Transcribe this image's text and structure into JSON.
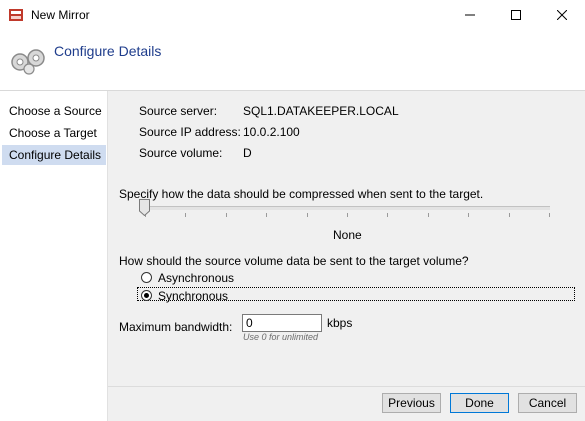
{
  "window": {
    "title": "New Mirror",
    "icon": "mirror-app-icon",
    "controls": {
      "minimize_icon": "minimize-icon",
      "maximize_icon": "maximize-icon",
      "close_icon": "close-icon"
    }
  },
  "header": {
    "title": "Configure Details",
    "icon": "gears-icon",
    "title_color": "#1f3d8c"
  },
  "sidebar": {
    "items": [
      {
        "label": "Choose a Source",
        "active": false
      },
      {
        "label": "Choose a Target",
        "active": false
      },
      {
        "label": "Configure Details",
        "active": true
      }
    ],
    "active_color": "#cfdcf0"
  },
  "details": {
    "source_server_label": "Source server:",
    "source_server_value": "SQL1.DATAKEEPER.LOCAL",
    "source_ip_label": "Source IP address:",
    "source_ip_value": "10.0.2.100",
    "source_volume_label": "Source volume:",
    "source_volume_value": "D"
  },
  "compression": {
    "prompt": "Specify how the data should be compressed when sent to the target.",
    "level_label": "None",
    "level": 0,
    "tick_count": 11
  },
  "replication": {
    "prompt": "How should the source volume data be sent to the target volume?",
    "options": [
      {
        "label": "Asynchronous",
        "selected": false
      },
      {
        "label": "Synchronous",
        "selected": true
      }
    ]
  },
  "bandwidth": {
    "label": "Maximum bandwidth:",
    "value": "0",
    "unit": "kbps",
    "hint": "Use 0 for unlimited"
  },
  "buttons": {
    "previous": "Previous",
    "done": "Done",
    "cancel": "Cancel"
  }
}
